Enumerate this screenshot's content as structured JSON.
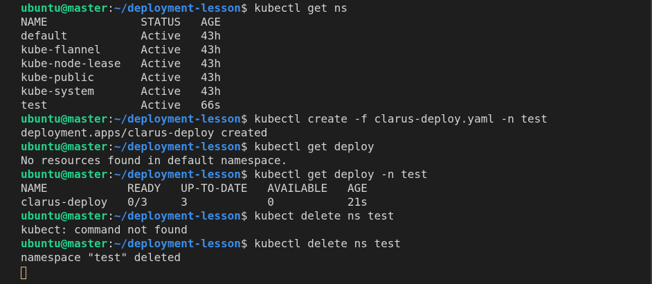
{
  "prompt": {
    "user": "ubuntu@master",
    "sep": ":",
    "path": "~/deployment-lesson",
    "symbol": "$"
  },
  "lines": [
    {
      "type": "cmd",
      "text": " kubectl get ns"
    },
    {
      "type": "out",
      "text": "NAME              STATUS   AGE"
    },
    {
      "type": "out",
      "text": "default           Active   43h"
    },
    {
      "type": "out",
      "text": "kube-flannel      Active   43h"
    },
    {
      "type": "out",
      "text": "kube-node-lease   Active   43h"
    },
    {
      "type": "out",
      "text": "kube-public       Active   43h"
    },
    {
      "type": "out",
      "text": "kube-system       Active   43h"
    },
    {
      "type": "out",
      "text": "test              Active   66s"
    },
    {
      "type": "cmd",
      "text": " kubectl create -f clarus-deploy.yaml -n test"
    },
    {
      "type": "out",
      "text": "deployment.apps/clarus-deploy created"
    },
    {
      "type": "cmd",
      "text": " kubectl get deploy"
    },
    {
      "type": "out",
      "text": "No resources found in default namespace."
    },
    {
      "type": "cmd",
      "text": " kubectl get deploy -n test"
    },
    {
      "type": "out",
      "text": "NAME            READY   UP-TO-DATE   AVAILABLE   AGE"
    },
    {
      "type": "out",
      "text": "clarus-deploy   0/3     3            0           21s"
    },
    {
      "type": "cmd",
      "text": " kubect delete ns test"
    },
    {
      "type": "out",
      "text": "kubect: command not found"
    },
    {
      "type": "cmd",
      "text": " kubectl delete ns test"
    },
    {
      "type": "out",
      "text": "namespace \"test\" deleted"
    }
  ],
  "colors": {
    "background": "#1e1e1e",
    "prompt_user": "#23d18b",
    "prompt_path": "#3b8eea",
    "text": "#d4d4d4",
    "cursor": "#e5c07b"
  }
}
